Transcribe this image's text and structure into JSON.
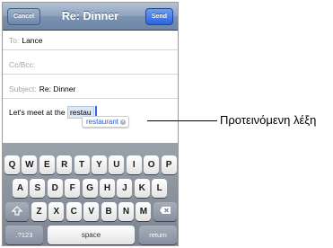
{
  "navbar": {
    "title": "Re: Dinner",
    "cancel_label": "Cancel",
    "send_label": "Send"
  },
  "fields": {
    "to_label": "To:",
    "to_value": "Lance",
    "cc_label": "Cc/Bcc:",
    "subject_label": "Subject:",
    "subject_value": "Re: Dinner"
  },
  "body": {
    "text_prefix": "Let's meet at the ",
    "typed_word": "restau"
  },
  "suggestion": {
    "word": "restaurant",
    "dismiss_icon": "close-icon"
  },
  "keyboard": {
    "row1": [
      "Q",
      "W",
      "E",
      "R",
      "T",
      "Y",
      "U",
      "I",
      "O",
      "P"
    ],
    "row2": [
      "A",
      "S",
      "D",
      "F",
      "G",
      "H",
      "J",
      "K",
      "L"
    ],
    "row3": [
      "Z",
      "X",
      "C",
      "V",
      "B",
      "N",
      "M"
    ],
    "shift_icon": "shift-icon",
    "delete_icon": "backspace-icon",
    "numbers_label": ".?123",
    "space_label": "space",
    "return_label": "return"
  },
  "callout": {
    "label": "Προτεινόμενη λέξη"
  }
}
